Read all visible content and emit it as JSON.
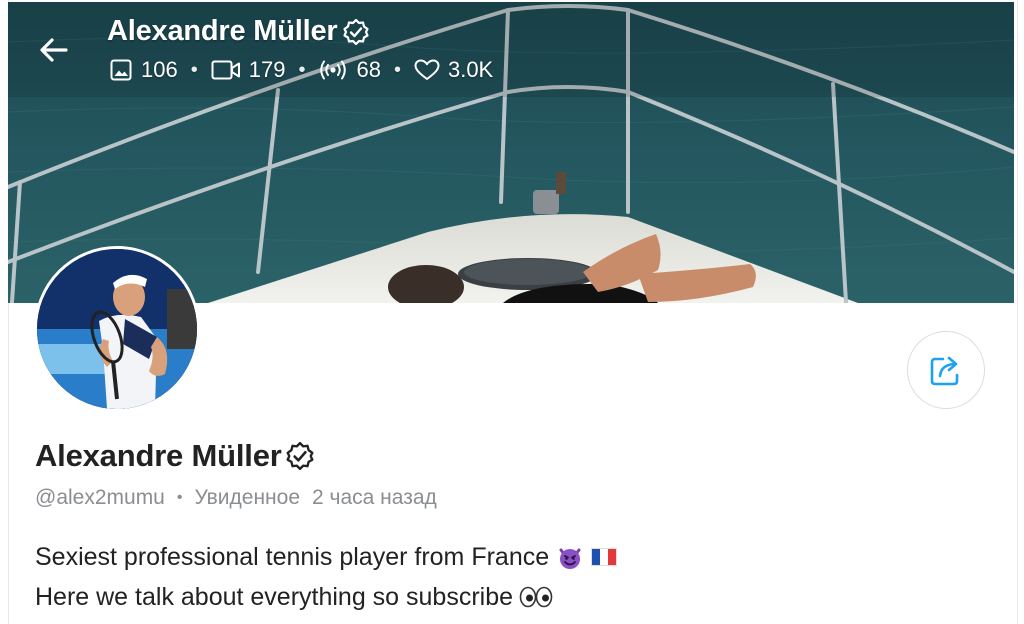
{
  "header": {
    "name": "Alexandre Müller",
    "stats": [
      {
        "icon": "image-icon",
        "value": "106"
      },
      {
        "icon": "video-icon",
        "value": "179"
      },
      {
        "icon": "broadcast-icon",
        "value": "68"
      },
      {
        "icon": "heart-icon",
        "value": "3.0K"
      }
    ]
  },
  "profile": {
    "name": "Alexandre Müller",
    "handle": "@alex2mumu",
    "seen_label": "Увиденное",
    "seen_time": "2 часа назад",
    "bio_line1": "Sexiest professional tennis player from France",
    "bio_line2": "Here we talk about everything so subscribe"
  },
  "colors": {
    "accent": "#1da1f2",
    "text": "#222222",
    "muted": "#8a8d91",
    "sea": "#245862"
  }
}
